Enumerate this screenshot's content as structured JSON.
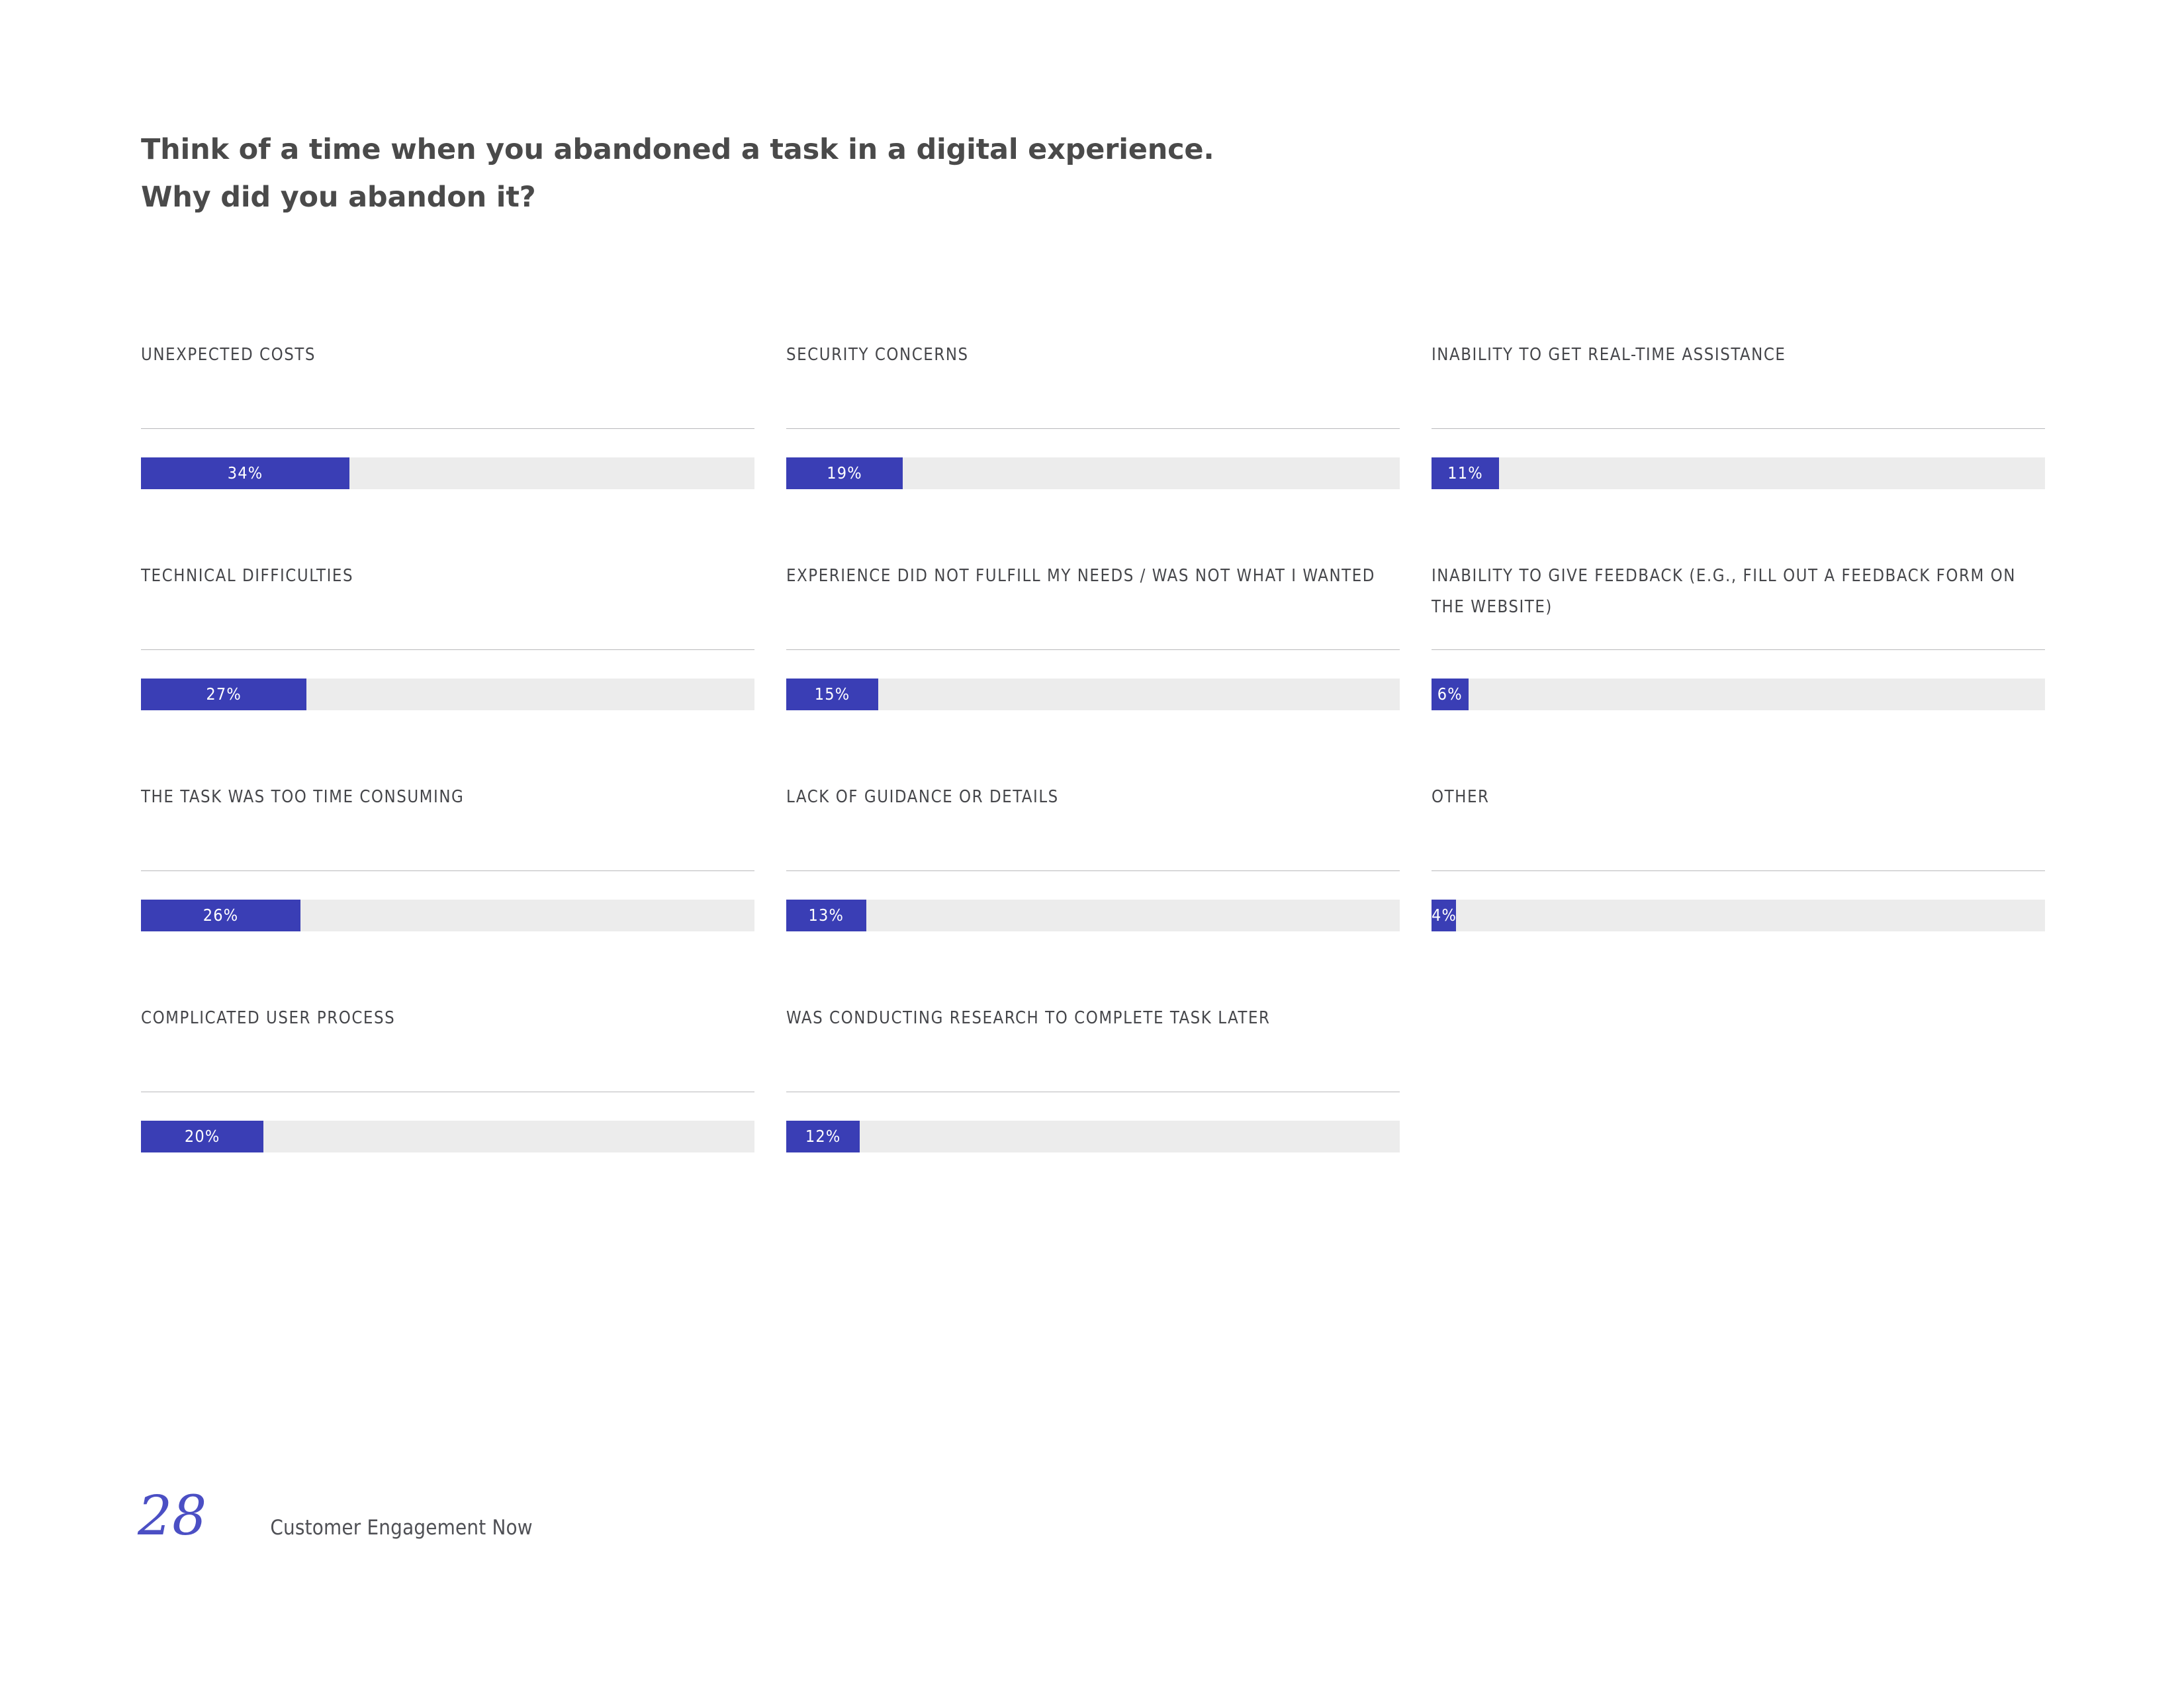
{
  "slide": {
    "title_lines": [
      "Think of a time when you abandoned a task in a digital experience.",
      "Why did you abandon it?"
    ],
    "page_number": "28",
    "footer_text": "Customer Engagement Now"
  },
  "theme": {
    "bar_color": "#3a3eb5",
    "track_color": "#ececec",
    "rule_color": "#b9b9bb",
    "label_color": "#45464a",
    "title_color": "#4a4a4a",
    "page_number_color": "#4b4fc4"
  },
  "chart_data": {
    "type": "bar",
    "title": "Think of a time when you abandoned a task in a digital experience. Why did you abandon it?",
    "xlabel": "",
    "ylabel": "",
    "xlim": [
      0,
      100
    ],
    "grid": false,
    "legend": "none",
    "orientation": "horizontal",
    "value_suffix": "%",
    "categories": [
      "UNEXPECTED COSTS",
      "TECHNICAL DIFFICULTIES",
      "THE TASK WAS TOO TIME CONSUMING",
      "COMPLICATED USER PROCESS",
      "SECURITY CONCERNS",
      "EXPERIENCE DID NOT FULFILL MY NEEDS / WAS NOT WHAT I WANTED",
      "LACK OF GUIDANCE OR DETAILS",
      "WAS CONDUCTING RESEARCH TO COMPLETE TASK LATER",
      "INABILITY TO GET REAL-TIME ASSISTANCE",
      "INABILITY TO GIVE FEEDBACK (E.G., FILL OUT A FEEDBACK FORM ON THE WEBSITE)",
      "OTHER"
    ],
    "values": [
      34,
      27,
      26,
      20,
      19,
      15,
      13,
      12,
      11,
      6,
      4
    ]
  },
  "columns": [
    {
      "cells": [
        {
          "label": "UNEXPECTED COSTS",
          "value": 34,
          "value_label": "34%"
        },
        {
          "label": "TECHNICAL DIFFICULTIES",
          "value": 27,
          "value_label": "27%"
        },
        {
          "label": "THE TASK WAS TOO TIME CONSUMING",
          "value": 26,
          "value_label": "26%"
        },
        {
          "label": "COMPLICATED USER PROCESS",
          "value": 20,
          "value_label": "20%"
        }
      ]
    },
    {
      "cells": [
        {
          "label": "SECURITY CONCERNS",
          "value": 19,
          "value_label": "19%"
        },
        {
          "label": "EXPERIENCE DID NOT FULFILL MY NEEDS / WAS NOT WHAT I WANTED",
          "value": 15,
          "value_label": "15%"
        },
        {
          "label": "LACK OF GUIDANCE OR DETAILS",
          "value": 13,
          "value_label": "13%"
        },
        {
          "label": "WAS CONDUCTING RESEARCH TO COMPLETE TASK LATER",
          "value": 12,
          "value_label": "12%"
        }
      ]
    },
    {
      "cells": [
        {
          "label": "INABILITY TO GET REAL-TIME ASSISTANCE",
          "value": 11,
          "value_label": "11%"
        },
        {
          "label": "INABILITY TO GIVE FEEDBACK (E.G., FILL OUT A FEEDBACK FORM ON THE WEBSITE)",
          "value": 6,
          "value_label": "6%"
        },
        {
          "label": "OTHER",
          "value": 4,
          "value_label": "4%"
        }
      ]
    }
  ]
}
